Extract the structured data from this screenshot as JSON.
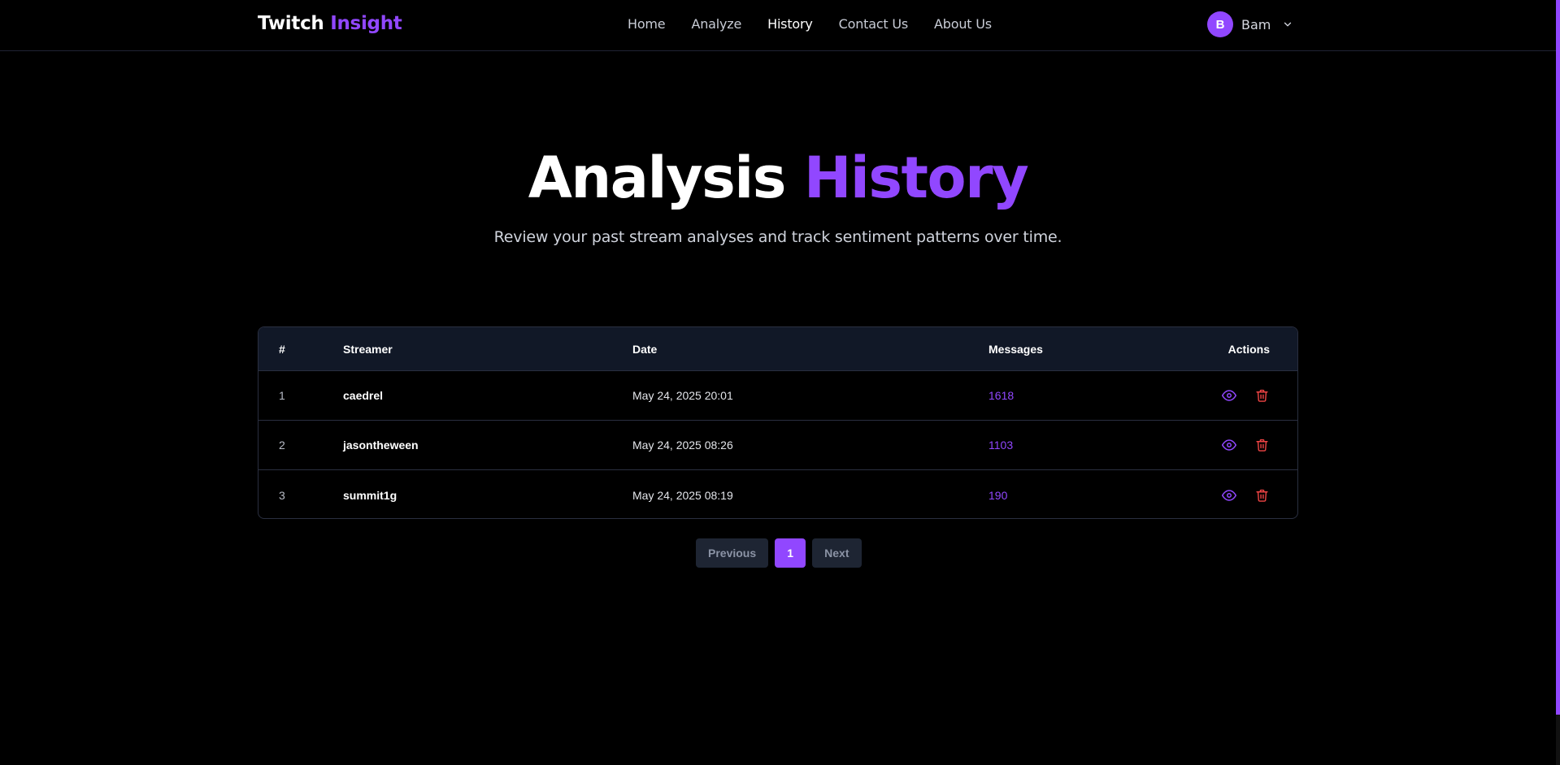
{
  "header": {
    "logo_part1": "Twitch",
    "logo_part2": "Insight",
    "nav": [
      {
        "label": "Home",
        "active": false
      },
      {
        "label": "Analyze",
        "active": false
      },
      {
        "label": "History",
        "active": true
      },
      {
        "label": "Contact Us",
        "active": false
      },
      {
        "label": "About Us",
        "active": false
      }
    ],
    "user": {
      "initial": "B",
      "name": "Bam",
      "menu_icon": "chevron-down-icon"
    }
  },
  "hero": {
    "title_part1": "Analysis",
    "title_part2": "History",
    "subtitle": "Review your past stream analyses and track sentiment patterns over time."
  },
  "table": {
    "columns": {
      "num": "#",
      "streamer": "Streamer",
      "date": "Date",
      "messages": "Messages",
      "actions": "Actions"
    },
    "rows": [
      {
        "num": "1",
        "streamer": "caedrel",
        "date": "May 24, 2025 20:01",
        "messages": "1618"
      },
      {
        "num": "2",
        "streamer": "jasontheween",
        "date": "May 24, 2025 08:26",
        "messages": "1103"
      },
      {
        "num": "3",
        "streamer": "summit1g",
        "date": "May 24, 2025 08:19",
        "messages": "190"
      }
    ],
    "row_actions": [
      "eye-icon",
      "trash-icon"
    ]
  },
  "pagination": {
    "previous": "Previous",
    "current": "1",
    "next": "Next"
  },
  "colors": {
    "accent": "#9147ff",
    "danger": "#ef4444",
    "background": "#000000",
    "table_header": "#111827"
  }
}
